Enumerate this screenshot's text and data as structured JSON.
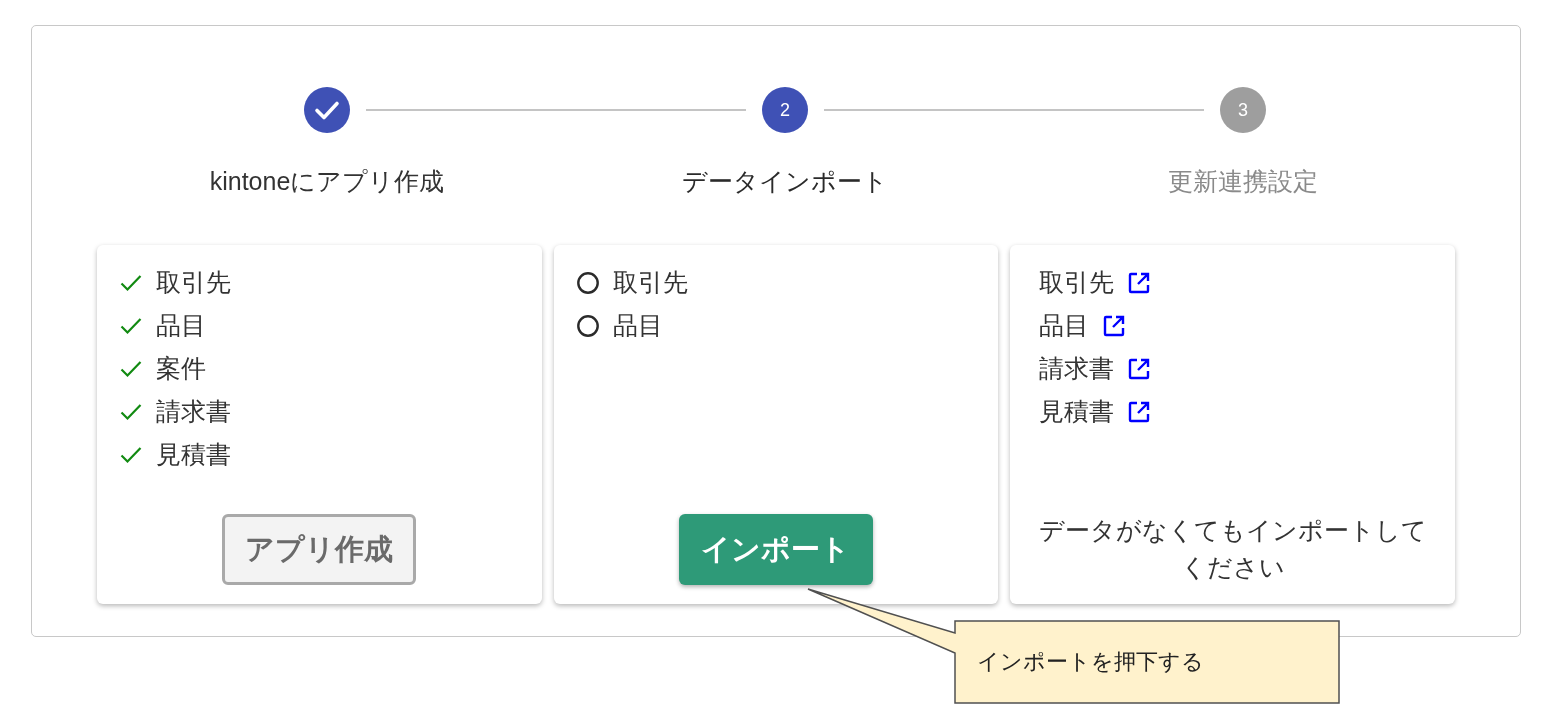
{
  "steps": [
    {
      "label": "kintoneにアプリ作成",
      "completed": true,
      "active": false
    },
    {
      "number": "2",
      "label": "データインポート",
      "completed": false,
      "active": true
    },
    {
      "number": "3",
      "label": "更新連携設定",
      "completed": false,
      "active": false
    }
  ],
  "panels": [
    {
      "kind": "checklist",
      "items": [
        {
          "label": "取引先",
          "checked": true
        },
        {
          "label": "品目",
          "checked": true
        },
        {
          "label": "案件",
          "checked": true
        },
        {
          "label": "請求書",
          "checked": true
        },
        {
          "label": "見積書",
          "checked": true
        }
      ],
      "button": {
        "label": "アプリ作成",
        "disabled": true
      }
    },
    {
      "kind": "checklist",
      "items": [
        {
          "label": "取引先",
          "checked": false
        },
        {
          "label": "品目",
          "checked": false
        }
      ],
      "button": {
        "label": "インポート",
        "disabled": false
      }
    },
    {
      "kind": "links",
      "items": [
        {
          "label": "取引先"
        },
        {
          "label": "品目"
        },
        {
          "label": "請求書"
        },
        {
          "label": "見積書"
        }
      ],
      "note": "データがなくてもインポートしてください"
    }
  ],
  "callout": {
    "text": "インポートを押下する"
  }
}
